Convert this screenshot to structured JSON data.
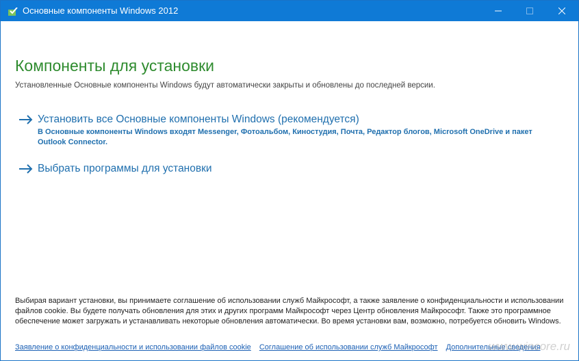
{
  "window": {
    "title": "Основные компоненты Windows 2012",
    "accent_color": "#0f7ad6"
  },
  "main": {
    "heading": "Компоненты для установки",
    "subheading": "Установленные Основные компоненты Windows будут автоматически закрыты и обновлены до последней версии.",
    "options": [
      {
        "label": "Установить все Основные компоненты Windows (рекомендуется)",
        "description": "В Основные компоненты Windows входят Messenger, Фотоальбом, Киностудия, Почта, Редактор блогов, Microsoft OneDrive и пакет Outlook Connector."
      },
      {
        "label": "Выбрать программы для установки",
        "description": ""
      }
    ],
    "legal_text": "Выбирая вариант установки, вы принимаете соглашение об использовании служб Майкрософт, а также заявление о конфиденциальности и использовании файлов cookie. Вы будете получать обновления для этих и других программ Майкрософт через Центр обновления Майкрософт. Также это программное обеспечение может загружать и устанавливать некоторые обновления автоматически. Во время установки вам, возможно, потребуется обновить Windows.",
    "links": [
      "Заявление о конфиденциальности и использовании файлов cookie",
      "Соглашение об использовании служб Майкрософт",
      "Дополнительные сведения"
    ]
  },
  "watermark": "www.wincore.ru",
  "icons": {
    "app": "windows-essentials-icon",
    "option_arrow": "arrow-right-icon",
    "minimize": "minimize-icon",
    "maximize": "maximize-icon",
    "close": "close-icon"
  }
}
